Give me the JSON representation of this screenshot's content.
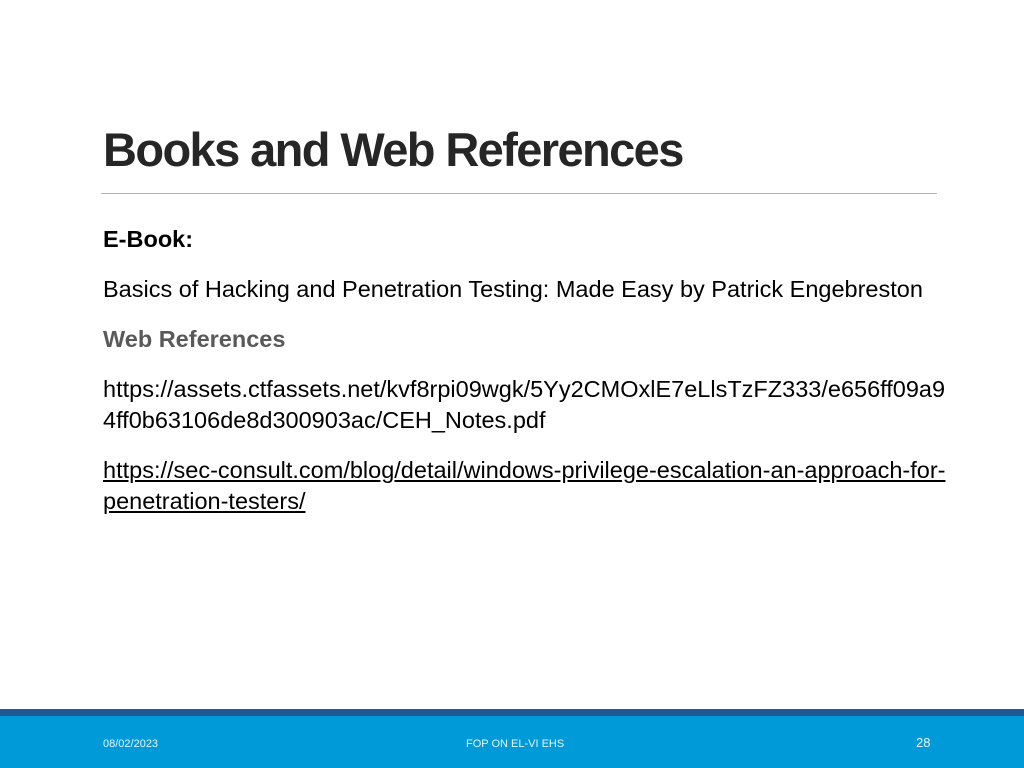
{
  "slide": {
    "title": "Books and Web References",
    "ebook_label": "E-Book:",
    "book_citation": "Basics of Hacking and Penetration Testing: Made Easy by Patrick Engebreston",
    "web_label": "Web References",
    "references": [
      "https://assets.ctfassets.net/kvf8rpi09wgk/5Yy2CMOxlE7eLlsTzFZ333/e656ff09a94ff0b63106de8d300903ac/CEH_Notes.pdf",
      "https://sec-consult.com/blog/detail/windows-privilege-escalation-an-approach-for-penetration-testers/"
    ]
  },
  "footer": {
    "date": "08/02/2023",
    "center_text": "FOP ON EL-VI EHS",
    "page_number": "28"
  },
  "colors": {
    "title": "#262626",
    "web_label": "#595959",
    "footer_stripe": "#1f5a96",
    "footer_band": "#009ad8"
  }
}
